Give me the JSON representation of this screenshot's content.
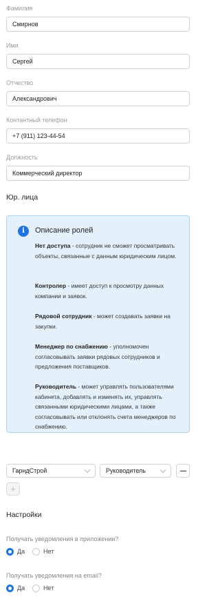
{
  "fields": [
    {
      "label": "Фамилия",
      "value": "Смирнов"
    },
    {
      "label": "Имя",
      "value": "Сергей"
    },
    {
      "label": "Отчество",
      "value": "Александрович"
    },
    {
      "label": "Контантный телефон",
      "value": "+7 (911) 123-44-54"
    },
    {
      "label": "Должность",
      "value": "Коммерческий директор"
    }
  ],
  "legal_section_title": "Юр. лица",
  "roles_info": {
    "icon": "info-icon",
    "title": "Описание ролей",
    "roles": [
      {
        "name": "Нет доступа",
        "description": " - сотрудник не сможет просматривать объекты, связанные с данным юридическим лицом."
      },
      {
        "name": "Контролер",
        "description": " - имеет доступ к просмотру данных компании и заявок."
      },
      {
        "name": "Рядовой сотрудник",
        "description": " - может создавать заявки на закупки."
      },
      {
        "name": "Менеджер по снабжению",
        "description": " - уполномочен согласовывать заявки рядовых сотрудников и предложения поставщиков."
      },
      {
        "name": "Руководитель",
        "description": " - может управлять пользователями кабинета, добавлять и изменять их, управлять связанными юридическими лицами, а также согласовывать или отклонять счета менеджеров по снабжению."
      }
    ]
  },
  "assignment": {
    "company": "ГарндСтрой",
    "role": "Руководитель"
  },
  "settings": {
    "title": "Настройки",
    "app_notifications": {
      "question": "Получать уведомления в приложении?",
      "yes": "Да",
      "no": "Нет",
      "selected": "yes"
    },
    "email_notifications": {
      "question": "Получать уведомления на email?",
      "yes": "Да",
      "no": "Нет",
      "selected": "yes"
    }
  },
  "colors": {
    "accent": "#1e73e6",
    "info_bg": "#e4f1fb",
    "info_border": "#aed3f0"
  }
}
